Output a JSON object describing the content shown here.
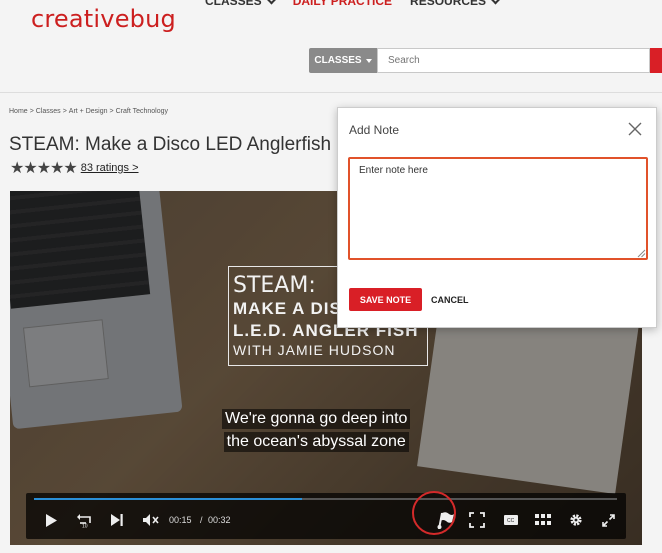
{
  "brand": {
    "logo_text": "creativebug"
  },
  "topnav": {
    "items": [
      {
        "label": "CLASSES"
      },
      {
        "label": "DAILY PRACTICE"
      },
      {
        "label": "RESOURCES"
      }
    ]
  },
  "search": {
    "category_label": "CLASSES",
    "placeholder": "Search"
  },
  "breadcrumb": [
    "Home",
    ">",
    "Classes",
    ">",
    "Art + Design",
    ">",
    "Craft Technology"
  ],
  "page": {
    "title": "STEAM: Make a Disco LED Anglerfish",
    "stars": "★★★★★",
    "ratings_link": "83 ratings >"
  },
  "video": {
    "title_lines": [
      "STEAM:",
      "MAKE A DIS",
      "L.E.D. ANGLER FISH",
      "WITH JAMIE HUDSON"
    ],
    "captions": [
      "We're gonna go deep into",
      "the ocean's abyssal zone"
    ],
    "current_time": "00:15",
    "time_separator": "/",
    "duration": "00:32",
    "progress_fraction": 0.46
  },
  "modal": {
    "title": "Add Note",
    "placeholder": "Enter note here",
    "save_label": "SAVE NOTE",
    "cancel_label": "CANCEL"
  },
  "colors": {
    "brand_red": "#d91f26",
    "focus_orange": "#e1522a",
    "progress_blue": "#2a8fd8"
  }
}
